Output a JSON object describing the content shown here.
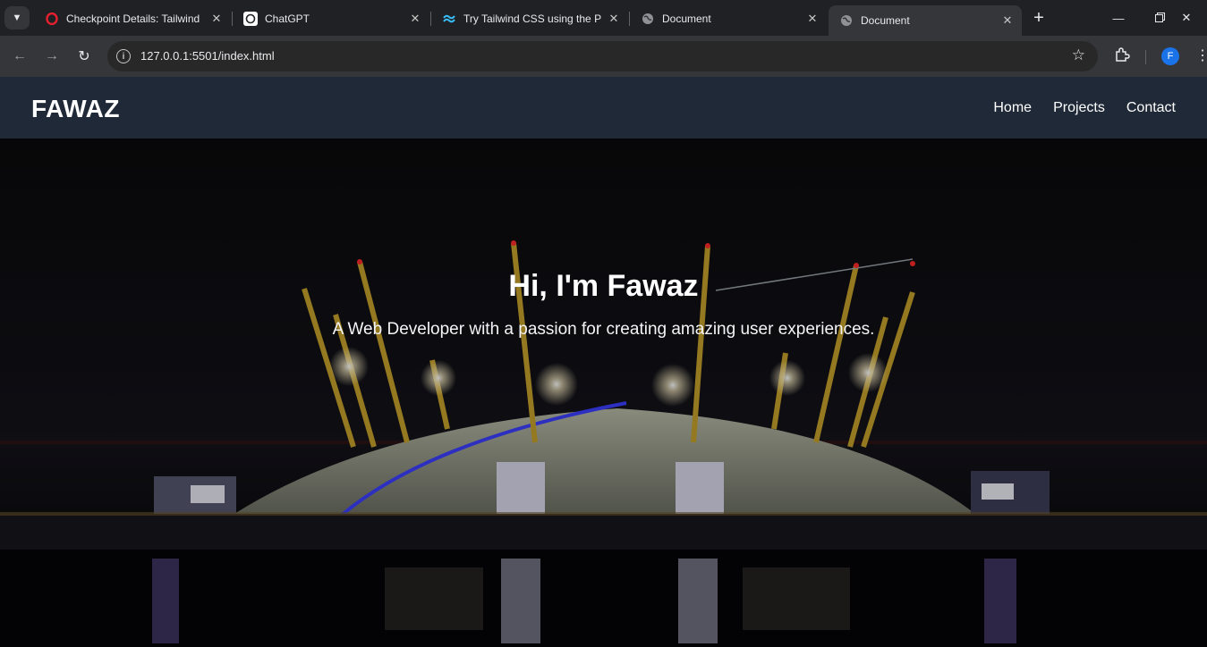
{
  "browser": {
    "tabs": [
      {
        "title": "Checkpoint Details: Tailwind",
        "icon": "opera-icon"
      },
      {
        "title": "ChatGPT",
        "icon": "chatgpt-icon"
      },
      {
        "title": "Try Tailwind CSS using the Pl",
        "icon": "tailwind-icon"
      },
      {
        "title": "Document",
        "icon": "globe-icon"
      },
      {
        "title": "Document",
        "icon": "globe-icon",
        "active": true
      }
    ],
    "url": "127.0.0.1:5501/index.html",
    "profile_initial": "F",
    "accent_color": "#1a73e8"
  },
  "site": {
    "brand": "FAWAZ",
    "nav": [
      "Home",
      "Projects",
      "Contact"
    ],
    "hero_title": "Hi, I'm Fawaz",
    "hero_subtitle": "A Web Developer with a passion for creating amazing user experiences.",
    "nav_color": "#1f2937"
  }
}
